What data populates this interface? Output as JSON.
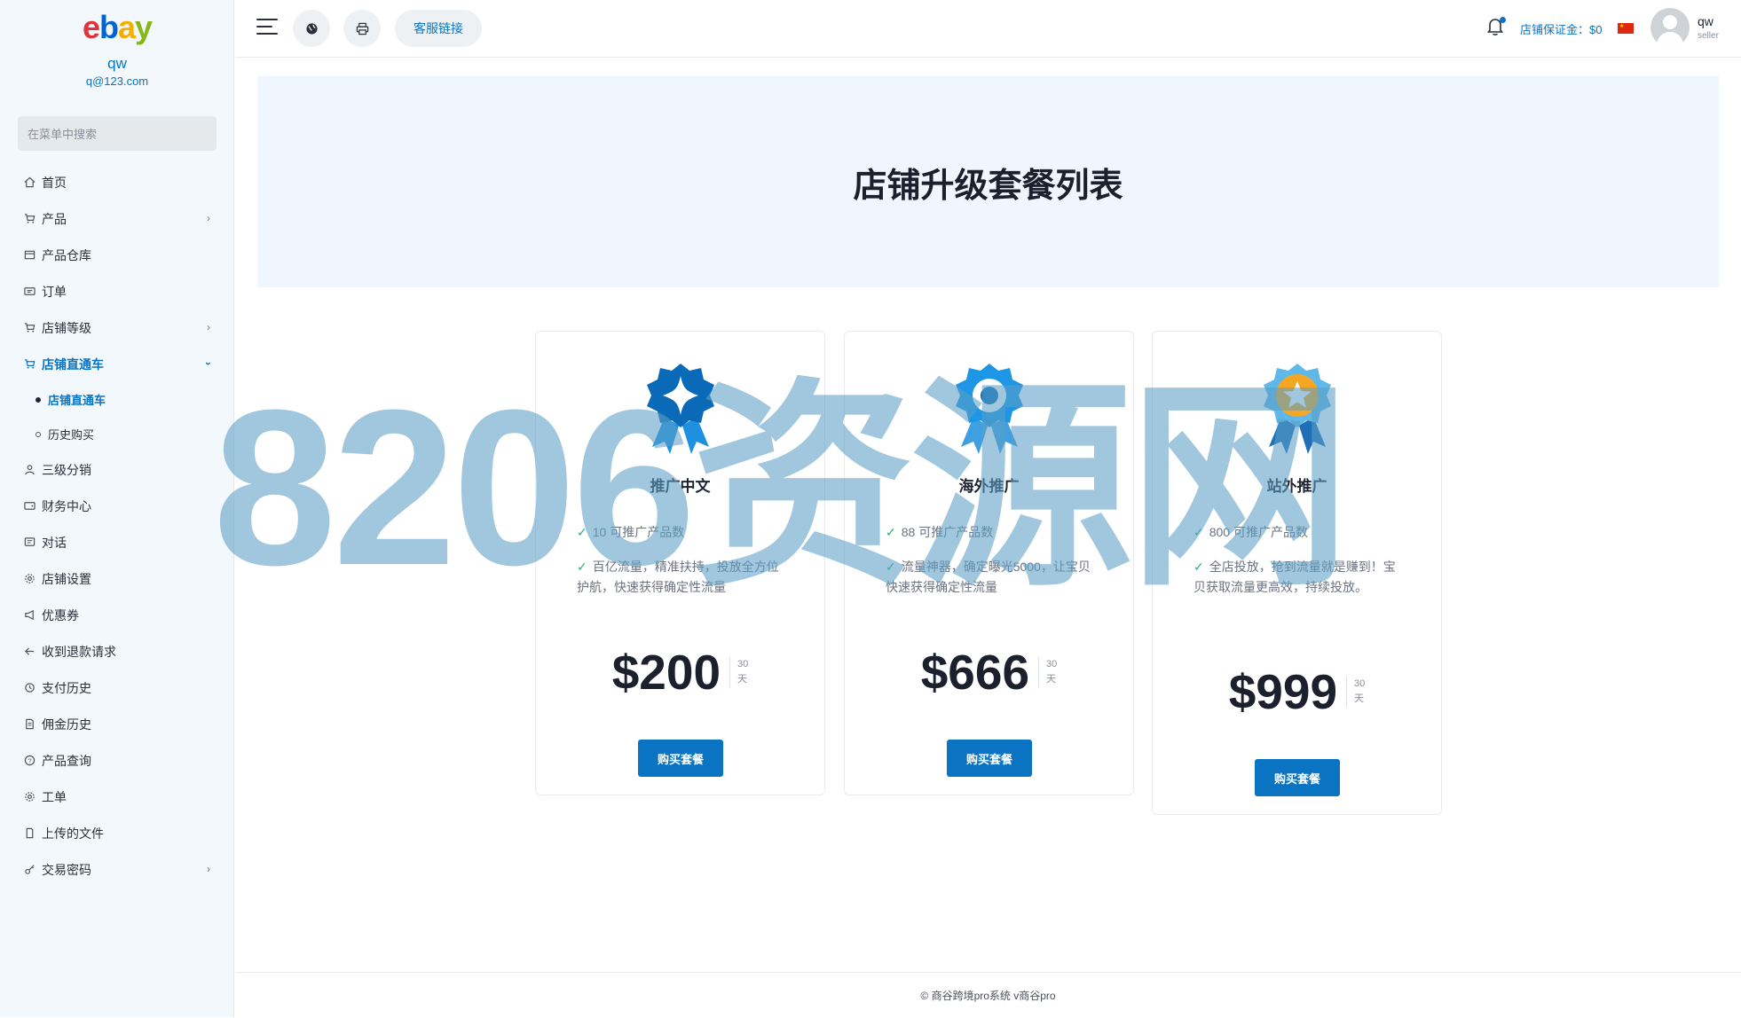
{
  "sidebar": {
    "logo_letters": [
      "e",
      "b",
      "a",
      "y"
    ],
    "user_name": "qw",
    "user_email": "q@123.com",
    "search_placeholder": "在菜单中搜索",
    "items": [
      {
        "label": "首页",
        "icon": "home-icon"
      },
      {
        "label": "产品",
        "icon": "cart-icon",
        "has_children": true
      },
      {
        "label": "产品仓库",
        "icon": "warehouse-icon"
      },
      {
        "label": "订单",
        "icon": "ticket-icon"
      },
      {
        "label": "店铺等级",
        "icon": "cart-icon",
        "has_children": true
      },
      {
        "label": "店铺直通车",
        "icon": "cart-icon",
        "has_children": true,
        "expanded": true,
        "active": true
      },
      {
        "label": "三级分销",
        "icon": "user-icon"
      },
      {
        "label": "财务中心",
        "icon": "wallet-icon"
      },
      {
        "label": "对话",
        "icon": "chat-icon"
      },
      {
        "label": "店铺设置",
        "icon": "gear-icon"
      },
      {
        "label": "优惠券",
        "icon": "megaphone-icon"
      },
      {
        "label": "收到退款请求",
        "icon": "refund-icon"
      },
      {
        "label": "支付历史",
        "icon": "history-icon"
      },
      {
        "label": "佣金历史",
        "icon": "document-icon"
      },
      {
        "label": "产品查询",
        "icon": "question-icon"
      },
      {
        "label": "工单",
        "icon": "gear-icon"
      },
      {
        "label": "上传的文件",
        "icon": "file-icon"
      },
      {
        "label": "交易密码",
        "icon": "key-icon",
        "has_children": true
      }
    ],
    "subitems": [
      {
        "label": "店铺直通车",
        "active": true
      },
      {
        "label": "历史购买",
        "active": false
      }
    ]
  },
  "topbar": {
    "support_link": "客服链接",
    "deposit": "店铺保证金：$0",
    "user_name": "qw",
    "user_role": "seller",
    "icons": [
      "menu-icon",
      "globe-icon",
      "printer-icon",
      "bell-icon",
      "china-flag-icon",
      "avatar-icon"
    ]
  },
  "banner": {
    "title": "店铺升级套餐列表"
  },
  "plans": [
    {
      "title": "推广中文",
      "medal": "diamond-medal-icon",
      "features": [
        "10 可推广产品数",
        "百亿流量，精准扶持，投放全方位护航，快速获得确定性流量"
      ],
      "price": "$200",
      "period_num": "30",
      "period_unit": "天",
      "button": "购买套餐"
    },
    {
      "title": "海外推广",
      "medal": "ring-medal-icon",
      "features": [
        "88 可推广产品数",
        "流量神器，确定曝光5000，让宝贝快速获得确定性流量"
      ],
      "price": "$666",
      "period_num": "30",
      "period_unit": "天",
      "button": "购买套餐"
    },
    {
      "title": "站外推广",
      "medal": "star-medal-icon",
      "features": [
        "800 可推广产品数",
        "全店投放，抢到流量就是赚到！宝贝获取流量更高效，持续投放。"
      ],
      "price": "$999",
      "period_num": "30",
      "period_unit": "天",
      "button": "购买套餐"
    }
  ],
  "footer": {
    "text": "© 商谷跨境pro系统 v商谷pro"
  },
  "watermark": "8206资源网",
  "colors": {
    "accent": "#0a74c2",
    "banner_bg": "#eff6fd",
    "sidebar_bg": "#f3f8fc",
    "check": "#20b36b"
  }
}
